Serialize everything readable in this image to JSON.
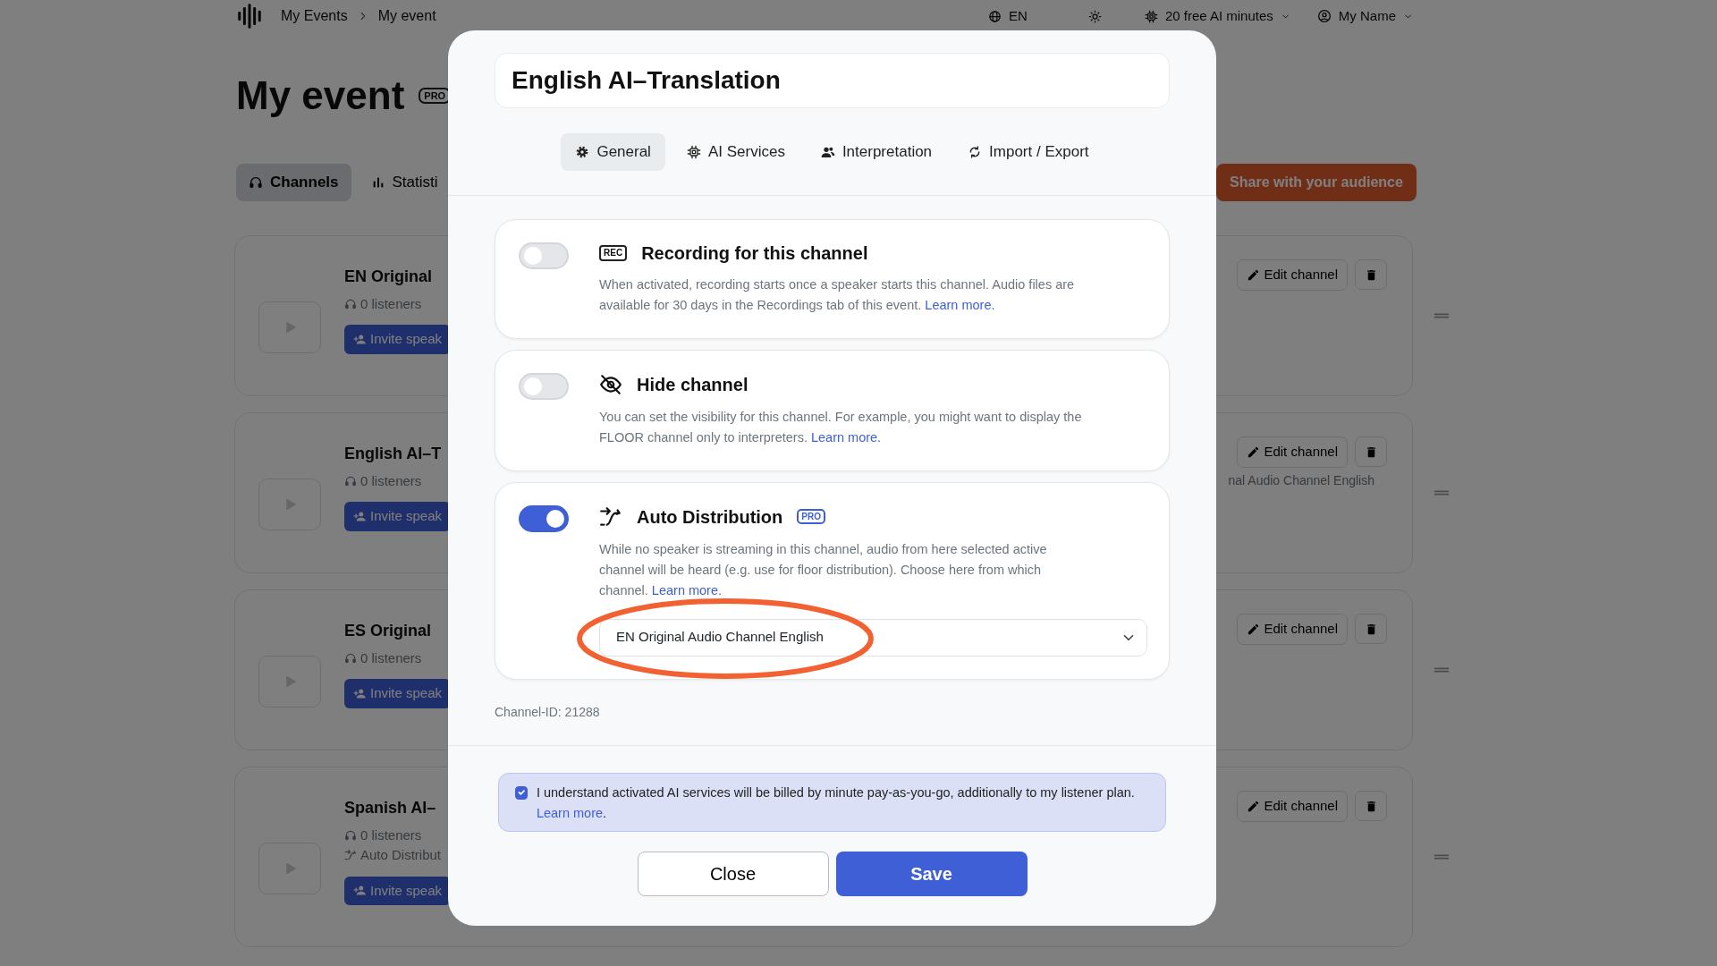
{
  "topbar": {
    "breadcrumbs": [
      "My Events",
      "My event"
    ],
    "language": "EN",
    "ai_minutes": "20 free AI minutes",
    "user": "My Name"
  },
  "page": {
    "title": "My event",
    "badge": "PRO",
    "tabs": [
      {
        "label": "Channels",
        "selected": true
      },
      {
        "label": "Statisti",
        "selected": false
      }
    ],
    "share_button": "Share with your audience",
    "channels": [
      {
        "name": "EN Original",
        "listeners": "0 listeners",
        "invite": "Invite speak",
        "edit": "Edit channel"
      },
      {
        "name": "English AI–T",
        "listeners": "0 listeners",
        "detail": "nal Audio Channel English",
        "invite": "Invite speak",
        "edit": "Edit channel"
      },
      {
        "name": "ES Original",
        "listeners": "0 listeners",
        "invite": "Invite speak",
        "edit": "Edit channel"
      },
      {
        "name": "Spanish AI–",
        "listeners": "0 listeners",
        "auto": "Auto Distribut",
        "invite": "Invite speak",
        "edit": "Edit channel"
      }
    ]
  },
  "dialog": {
    "title_value": "English AI–Translation",
    "tabs": [
      {
        "label": "General",
        "selected": true
      },
      {
        "label": "AI Services",
        "selected": false
      },
      {
        "label": "Interpretation",
        "selected": false
      },
      {
        "label": "Import / Export",
        "selected": false
      }
    ],
    "sections": [
      {
        "title": "Recording for this channel",
        "icon_text": "REC",
        "on": false,
        "description": "When activated, recording starts once a speaker starts this channel. Audio files are available for 30 days in the Recordings tab of this event.",
        "link": "Learn more."
      },
      {
        "title": "Hide channel",
        "on": false,
        "description": "You can set the visibility for this channel. For example, you might want to display the FLOOR channel only to interpreters.",
        "link": "Learn more."
      },
      {
        "title": "Auto Distribution",
        "badge": "PRO",
        "on": true,
        "description": "While no speaker is streaming in this channel, audio from here selected active channel will be heard (e.g. use for floor distribution). Choose here from which channel.",
        "link": "Learn more.",
        "select_value": "EN Original Audio Channel English",
        "highlighted": true
      }
    ],
    "channel_id": "Channel-ID: 21288",
    "consent": {
      "checked": true,
      "text": "I understand activated AI services will be billed by minute pay-as-you-go, additionally to my listener plan.",
      "link": "Learn more",
      "after": "."
    },
    "buttons": {
      "close": "Close",
      "save": "Save"
    }
  }
}
